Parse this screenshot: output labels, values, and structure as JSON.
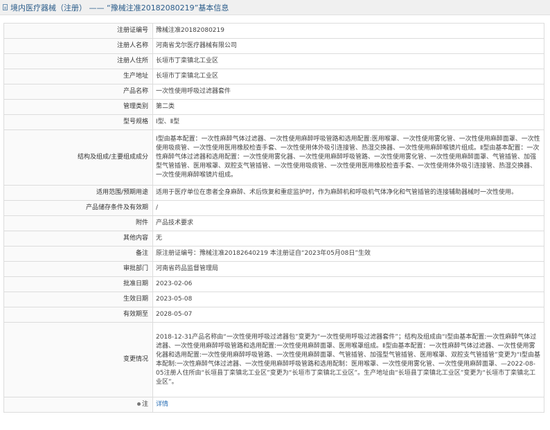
{
  "header": {
    "title": "境内医疗器械（注册） —— “豫械注准20182080219”基本信息"
  },
  "rows": [
    {
      "label": "注册证编号",
      "value": "豫械注准20182080219"
    },
    {
      "label": "注册人名称",
      "value": "河南省戈尔医疗器械有限公司"
    },
    {
      "label": "注册人住所",
      "value": "长垣市丁栾镇北工业区"
    },
    {
      "label": "生产地址",
      "value": "长垣市丁栾镇北工业区"
    },
    {
      "label": "产品名称",
      "value": "一次性使用呼吸过滤器套件"
    },
    {
      "label": "管理类别",
      "value": "第二类"
    },
    {
      "label": "型号规格",
      "value": "Ⅰ型、Ⅱ型"
    },
    {
      "label": "结构及组成/主要组成成分",
      "value": "Ⅰ型由基本配置：一次性麻醉气体过滤器、一次性使用麻醉呼吸管路和选用配置:医用喉罩、一次性使用雾化管、一次性使用麻醉面罩、一次性使用吸痰管、一次性使用医用橡胶检查手套、一次性使用体外吸引连接管、热湿交换器、一次性使用麻醉喉镜片组成。Ⅱ型由基本配置：一次性麻醉气体过滤器和选用配置：一次性使用雾化器、一次性使用麻醉呼吸管路、一次性使用雾化管、一次性使用麻醉面罩、气管插管、加强型气管插管、医用喉罩、双腔支气管插管、一次性使用吸痰管、一次性使用医用橡胶检查手套、一次性使用体外吸引连接管、热湿交换器、一次性使用麻醉喉镜片组成。"
    },
    {
      "label": "适用范围/预期用途",
      "value": "适用于医疗单位在患者全身麻醉、术后恢复和重症监护时，作为麻醉机和呼吸机气体净化和气管插管的连接辅助器械时一次性使用。"
    },
    {
      "label": "产品储存条件及有效期",
      "value": "/"
    },
    {
      "label": "附件",
      "value": "产品技术要求"
    },
    {
      "label": "其他内容",
      "value": "无"
    },
    {
      "label": "备注",
      "value": "原注册证编号：豫械注准20182640219 本注册证自“2023年05月08日”生效"
    },
    {
      "label": "审批部门",
      "value": "河南省药品监督管理局"
    },
    {
      "label": "批准日期",
      "value": "2023-02-06"
    },
    {
      "label": "生效日期",
      "value": "2023-05-08"
    },
    {
      "label": "有效期至",
      "value": "2028-05-07"
    },
    {
      "label": "变更情况",
      "value": "2018-12-31产品名称由“一次性使用呼吸过滤器包”变更为“一次性使用呼吸过滤器套件”；结构及组成由“Ⅰ型由基本配置:一次性麻醉气体过滤器、一次性使用麻醉呼吸管路和选用配置:一次性使用麻醉面罩、医用喉罩组成。Ⅱ型由基本配置：一次性麻醉气体过滤器、一次性使用雾化器和选用配置:一次性使用麻醉呼吸管路、一次性使用麻醉面罩、气管插管、加强型气管插管、医用喉罩、双腔支气管插管”变更为“Ⅰ型由基本配制:一次性麻醉气体过滤器、一次性使用麻醉呼吸管路和选用配制：医用喉罩、一次性使用雾化管、一次性使用麻醉面罩、—2022-08-05注册人住所由“长垣县丁栾镇北工业区”变更为“长垣市丁栾镇北工业区”。生产地址由“长垣县丁栾镇北工业区”变更为“长垣市丁栾镇北工业区”。"
    }
  ],
  "note": {
    "label": "注",
    "link": "详情"
  }
}
